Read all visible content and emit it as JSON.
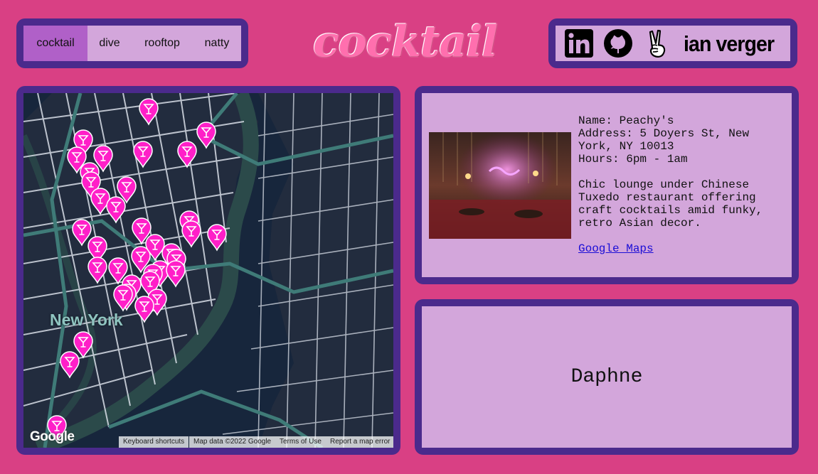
{
  "nav": {
    "tabs": [
      {
        "label": "cocktail",
        "active": true
      },
      {
        "label": "dive",
        "active": false
      },
      {
        "label": "rooftop",
        "active": false
      },
      {
        "label": "natty",
        "active": false
      }
    ]
  },
  "title": "cocktail",
  "social": {
    "icons": [
      "linkedin-icon",
      "github-icon",
      "peace-hand-icon"
    ],
    "name": "ian verger"
  },
  "map": {
    "place_label": "New York",
    "google_logo": "Google",
    "attribution": {
      "shortcuts": "Keyboard shortcuts",
      "data": "Map data ©2022 Google",
      "terms": "Terms of Use",
      "report": "Report a map error"
    },
    "marker_color": "#ff1fc8"
  },
  "detail": {
    "name_line": "Name: Peachy's",
    "address_line": "Address: 5 Doyers St, New York, NY 10013",
    "hours_line": "Hours: 6pm - 1am",
    "description": "Chic lounge under Chinese Tuxedo restaurant offering craft cocktails amid funky, retro Asian decor.",
    "maps_link": "Google Maps"
  },
  "featured": {
    "name": "Daphne"
  },
  "colors": {
    "background": "#d94084",
    "frame": "#4b2a8c",
    "card": "#d3a6db",
    "active_tab": "#b060c8",
    "map_bg": "#1b2233"
  }
}
